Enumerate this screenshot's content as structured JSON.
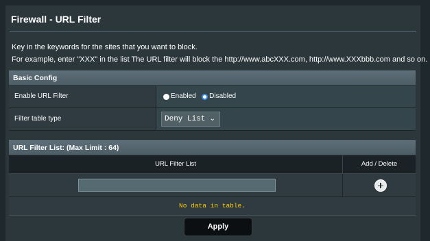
{
  "page": {
    "title": "Firewall - URL Filter",
    "description_line1": "Key in the keywords for the sites that you want to block.",
    "description_line2": "For example, enter \"XXX\" in the list The URL filter will block the http://www.abcXXX.com, http://www.XXXbbb.com and so on."
  },
  "basic_config": {
    "header": "Basic Config",
    "enable_label": "Enable URL Filter",
    "enabled_option": "Enabled",
    "disabled_option": "Disabled",
    "selected": "Disabled",
    "filter_type_label": "Filter table type",
    "filter_type_value": "Deny List"
  },
  "url_list": {
    "header": "URL Filter List: (Max Limit : 64)",
    "col_url": "URL Filter List",
    "col_action": "Add / Delete",
    "input_value": "",
    "empty_message": "No data in table."
  },
  "actions": {
    "apply_label": "Apply"
  },
  "icons": {
    "add": "plus-circle-icon",
    "dropdown": "chevron-down-icon"
  },
  "colors": {
    "background": "#2b373b",
    "header_band": "#5d6e78",
    "radio_selected": "#3b8eea",
    "empty_text": "#ffcc00"
  }
}
